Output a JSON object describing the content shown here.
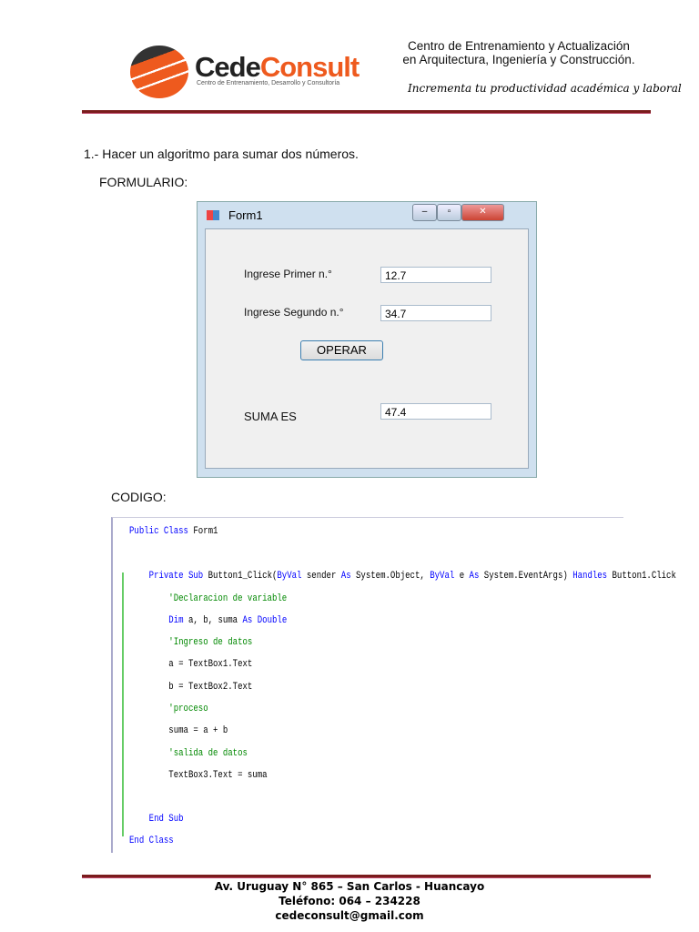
{
  "header": {
    "logo_a": "Cede",
    "logo_b": "Consult",
    "logo_sub": "Centro de Entrenamiento, Desarrollo y Consultoría",
    "line1": "Centro de Entrenamiento y Actualización",
    "line2": "en Arquitectura, Ingeniería y Construcción.",
    "motto": "Incrementa tu productividad académica y laboral"
  },
  "body": {
    "problem": "1.- Hacer un algoritmo para sumar dos números.",
    "form_heading": "FORMULARIO:",
    "code_heading": "CODIGO:"
  },
  "form": {
    "title": "Form1",
    "label1": "Ingrese Primer n.°",
    "value1": "12.7",
    "label2": "Ingrese Segundo n.°",
    "value2": "34.7",
    "button": "OPERAR",
    "label3": "SUMA ES",
    "value3": "47.4"
  },
  "code": [
    [
      [
        "k",
        "Public Class "
      ],
      [
        "n",
        "Form1"
      ]
    ],
    [
      [
        "k",
        "    Private Sub "
      ],
      [
        "n",
        "Button1_Click("
      ],
      [
        "k",
        "ByVal"
      ],
      [
        "n",
        " sender "
      ],
      [
        "k",
        "As"
      ],
      [
        "n",
        " System.Object, "
      ],
      [
        "k",
        "ByVal"
      ],
      [
        "n",
        " e "
      ],
      [
        "k",
        "As"
      ],
      [
        "n",
        " System.EventArgs) "
      ],
      [
        "k",
        "Handles"
      ],
      [
        "n",
        " Button1.Click"
      ]
    ],
    [
      [
        "c",
        "        'Declaracion de variable"
      ]
    ],
    [
      [
        "k",
        "        Dim"
      ],
      [
        "n",
        " a, b, suma "
      ],
      [
        "k",
        "As Double"
      ]
    ],
    [
      [
        "c",
        "        'Ingreso de datos"
      ]
    ],
    [
      [
        "n",
        "        a = TextBox1.Text"
      ]
    ],
    [
      [
        "n",
        "        b = TextBox2.Text"
      ]
    ],
    [
      [
        "c",
        "        'proceso"
      ]
    ],
    [
      [
        "n",
        "        suma = a + b"
      ]
    ],
    [
      [
        "c",
        "        'salida de datos"
      ]
    ],
    [
      [
        "n",
        "        TextBox3.Text = suma"
      ]
    ],
    [
      [
        "k",
        "    End Sub"
      ]
    ],
    [
      [
        "k",
        "End Class"
      ]
    ]
  ],
  "footer": {
    "address": "Av. Uruguay N° 865 – San Carlos - Huancayo",
    "phone": "Teléfono: 064 – 234228",
    "email": "cedeconsult@gmail.com"
  }
}
